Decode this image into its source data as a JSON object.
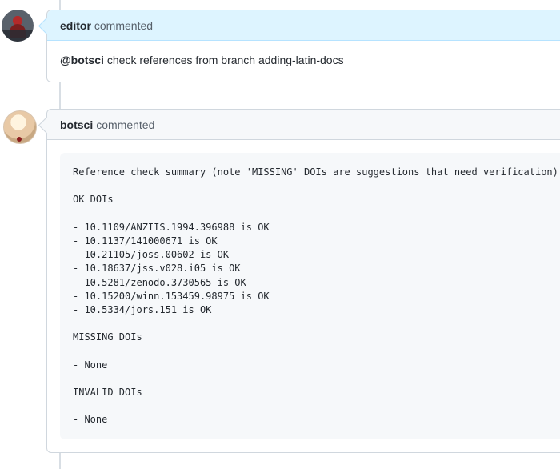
{
  "comments": [
    {
      "author": "editor",
      "action": "commented",
      "mention": "@botsci",
      "text": "check references from branch adding-latin-docs"
    },
    {
      "author": "botsci",
      "action": "commented",
      "report": {
        "summary": "Reference check summary (note 'MISSING' DOIs are suggestions that need verification):",
        "ok_heading": "OK DOIs",
        "ok_items": [
          "- 10.1109/ANZIIS.1994.396988 is OK",
          "- 10.1137/141000671 is OK",
          "- 10.21105/joss.00602 is OK",
          "- 10.18637/jss.v028.i05 is OK",
          "- 10.5281/zenodo.3730565 is OK",
          "- 10.15200/winn.153459.98975 is OK",
          "- 10.5334/jors.151 is OK"
        ],
        "missing_heading": "MISSING DOIs",
        "missing_items": [
          "- None"
        ],
        "invalid_heading": "INVALID DOIs",
        "invalid_items": [
          "- None"
        ]
      }
    }
  ]
}
